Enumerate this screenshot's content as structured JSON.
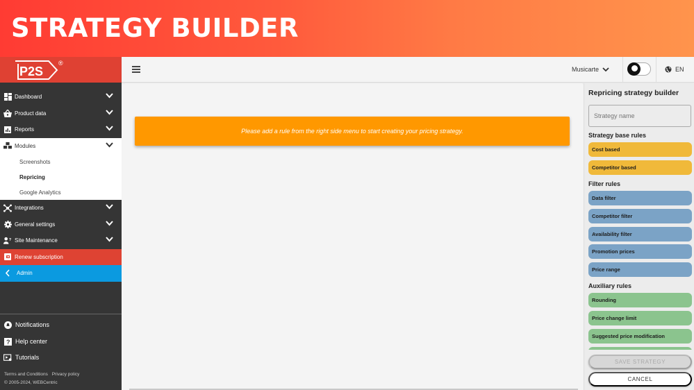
{
  "banner": {
    "title": "STRATEGY BUILDER"
  },
  "logo": {
    "text": "P2S",
    "registered": "®"
  },
  "sidebar": {
    "items": [
      {
        "label": "Dashboard",
        "icon": "dashboard-icon"
      },
      {
        "label": "Product data",
        "icon": "basket-icon"
      },
      {
        "label": "Reports",
        "icon": "chart-icon"
      },
      {
        "label": "Modules",
        "icon": "modules-icon",
        "expanded": true,
        "children": [
          {
            "label": "Screenshots"
          },
          {
            "label": "Repricing",
            "selected": true
          },
          {
            "label": "Google Analytics"
          }
        ]
      },
      {
        "label": "Integrations",
        "icon": "integrations-icon"
      },
      {
        "label": "General settings",
        "icon": "gear-icon"
      },
      {
        "label": "Site Maintenance",
        "icon": "maintenance-icon"
      }
    ],
    "renew": {
      "label": "Renew subscription"
    },
    "admin": {
      "label": "Admin"
    },
    "bottom": [
      {
        "label": "Notifications",
        "icon": "bell-icon"
      },
      {
        "label": "Help center",
        "icon": "help-icon"
      },
      {
        "label": "Tutorials",
        "icon": "tutorials-icon"
      }
    ],
    "footer_links": [
      "Terms and Conditions",
      "Privacy policy"
    ],
    "copyright": "© 2005-2024, WEBCentric"
  },
  "topbar": {
    "account": "Musicarte",
    "language": "EN",
    "dark_mode": true
  },
  "main": {
    "alert": "Please add a rule from the right side menu to start creating your pricing strategy."
  },
  "panel": {
    "title": "Repricing strategy builder",
    "name_placeholder": "Strategy name",
    "sections": {
      "base": "Strategy base rules",
      "filter": "Filter rules",
      "aux": "Auxiliary rules"
    },
    "base_rules": [
      "Cost based",
      "Competitor based"
    ],
    "filter_rules": [
      "Data filter",
      "Competitor filter",
      "Availability filter",
      "Promotion prices",
      "Price range"
    ],
    "aux_rules": [
      "Rounding",
      "Price change limit",
      "Suggested price modification"
    ],
    "save_label": "SAVE STRATEGY",
    "cancel_label": "CANCEL"
  },
  "colors": {
    "brand_red": "#df4133",
    "admin_blue": "#0b9ae0",
    "alert_orange": "#ff9800",
    "base_rule": "#f0b93a",
    "filter_rule": "#7ba3c6",
    "aux_rule": "#8bc48e"
  }
}
